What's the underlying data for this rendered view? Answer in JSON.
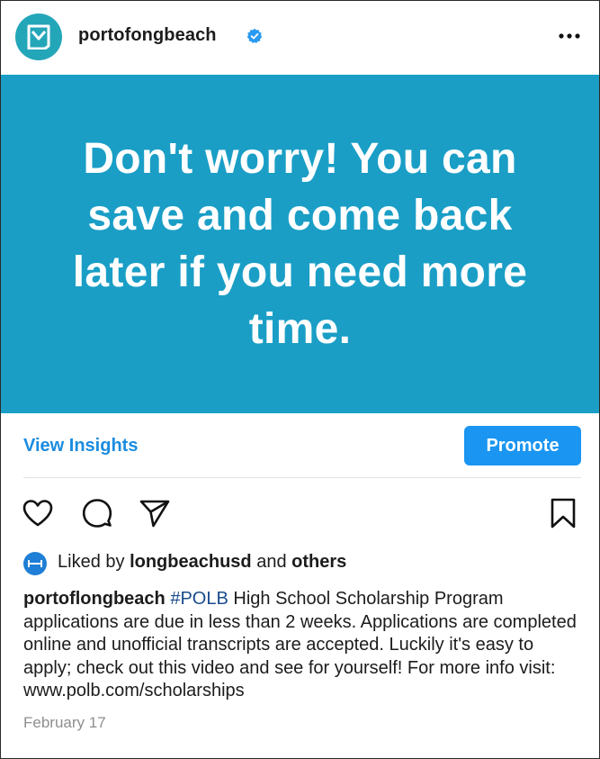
{
  "header": {
    "username": "portofongbeach",
    "verified_icon": "verified-badge-icon",
    "more_icon": "more-horizontal-icon"
  },
  "post": {
    "image_text": "Don't worry! You can save and come back later if you need more time.",
    "image_bg_color": "#1a9ec6"
  },
  "insights": {
    "view_insights_label": "View Insights",
    "promote_label": "Promote"
  },
  "actions": {
    "like_icon": "heart-icon",
    "comment_icon": "comment-icon",
    "share_icon": "send-icon",
    "save_icon": "bookmark-icon"
  },
  "likes": {
    "prefix": "Liked by",
    "user": "longbeachusd",
    "conjunction": "and",
    "others": "others"
  },
  "caption": {
    "author": "portoflongbeach",
    "hashtag": "#POLB",
    "text": "High School Scholarship Program applications are due in less than 2 weeks. Applications are completed online and unofficial transcripts are accepted. Luckily it's easy to apply; check out this video and see for yourself! For more info visit:  www.polb.com/scholarships"
  },
  "date": "February 17",
  "colors": {
    "accent": "#1a95f2",
    "link": "#1a8ce0",
    "hashtag": "#1a4c8c",
    "avatar": "#24a6b9"
  }
}
